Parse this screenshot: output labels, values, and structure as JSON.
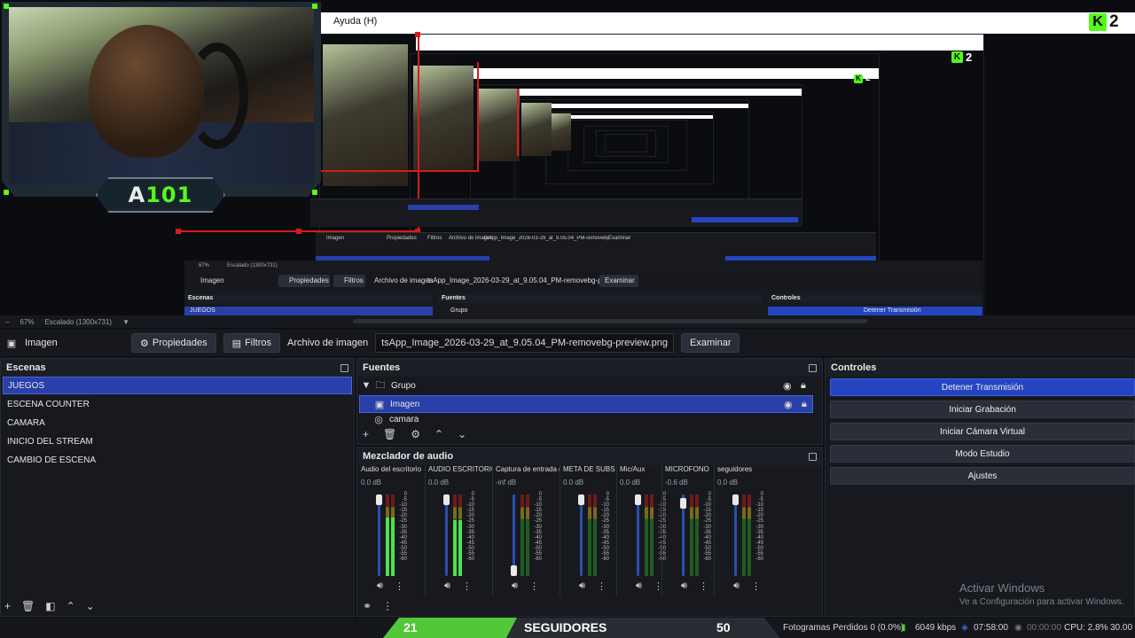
{
  "preview": {
    "menu_help": "Ayuda (H)",
    "k2_letter": "K",
    "k2_number": "2",
    "badge_letter": "A",
    "badge_number": "101",
    "nested": {
      "help": "Ayuda (H)",
      "zoom": "67%",
      "scale": "Escalado (1300x731)",
      "source": "Imagen",
      "properties": "Propiedades",
      "filters": "Filtros",
      "file_label": "Archivo de imagen",
      "file_value": "tsApp_Image_2026-03-29_at_9.05.04_PM-removebg-preview.png",
      "browse": "Examinar",
      "scenes": "Escenas",
      "sources": "Fuentes",
      "controls": "Controles",
      "scene_selected": "JUEGOS",
      "group": "Grupo",
      "stop": "Detener Transmisión"
    }
  },
  "preview_status": {
    "zoom": "67%",
    "scale": "Escalado (1300x731)"
  },
  "source_toolbar": {
    "source_name": "Imagen",
    "properties_label": "Propiedades",
    "filters_label": "Filtros",
    "file_label": "Archivo de imagen",
    "file_value": "tsApp_Image_2026-03-29_at_9.05.04_PM-removebg-preview.png",
    "browse_label": "Examinar"
  },
  "scenes": {
    "title": "Escenas",
    "items": [
      {
        "label": "JUEGOS",
        "selected": true
      },
      {
        "label": "ESCENA COUNTER"
      },
      {
        "label": "CAMARA"
      },
      {
        "label": "INICIO DEL STREAM"
      },
      {
        "label": "CAMBIO DE ESCENA"
      }
    ]
  },
  "sources": {
    "title": "Fuentes",
    "items": [
      {
        "label": "Grupo",
        "type": "folder"
      },
      {
        "label": "Imagen",
        "type": "image",
        "selected": true
      },
      {
        "label": "camara",
        "type": "camera"
      }
    ]
  },
  "controls": {
    "title": "Controles",
    "buttons": [
      "Detener Transmisión",
      "Iniciar Grabación",
      "Iniciar Cámara Virtual",
      "Modo Estudio",
      "Ajustes"
    ]
  },
  "mixer": {
    "title": "Mezclador de audio",
    "channels": [
      {
        "name": "Audio del escritorio",
        "db": "0.0 dB",
        "volume": 1.0,
        "level": 0.72
      },
      {
        "name": "AUDIO ESCRITORIO",
        "db": "0.0 dB",
        "volume": 1.0,
        "level": 0.68
      },
      {
        "name": "Captura de entrada de audio",
        "db": "-inf dB",
        "volume": 0.0,
        "level": 0.0
      },
      {
        "name": "META DE SUBS",
        "db": "0.0 dB",
        "volume": 1.0,
        "level": 0.0
      },
      {
        "name": "Mic/Aux",
        "db": "0.0 dB",
        "volume": 1.0,
        "level": 0.0
      },
      {
        "name": "MICROFONO",
        "db": "-0.6 dB",
        "volume": 0.95,
        "level": 0.0
      },
      {
        "name": "seguidores",
        "db": "0.0 dB",
        "volume": 1.0,
        "level": 0.0
      }
    ],
    "scale": [
      "0",
      "-5",
      "-10",
      "-15",
      "-20",
      "-25",
      "-30",
      "-35",
      "-40",
      "-45",
      "-50",
      "-55",
      "-60"
    ]
  },
  "follow_goal": {
    "current": "21",
    "label": "SEGUIDORES",
    "target": "50",
    "progress": 0.42
  },
  "status": {
    "dropped": "Fotogramas Perdidos 0 (0.0%)",
    "bitrate": "6049 kbps",
    "live_time": "07:58:00",
    "rec_time": "00:00:00",
    "cpu": "CPU: 2.8%",
    "fps": "30.00 /"
  },
  "watermark": {
    "title": "Activar Windows",
    "subtitle": "Ve a Configuración para activar Windows."
  },
  "colors": {
    "accent": "#2545c0",
    "kick_green": "#53fc18",
    "recording_red": "#d81a1a"
  }
}
